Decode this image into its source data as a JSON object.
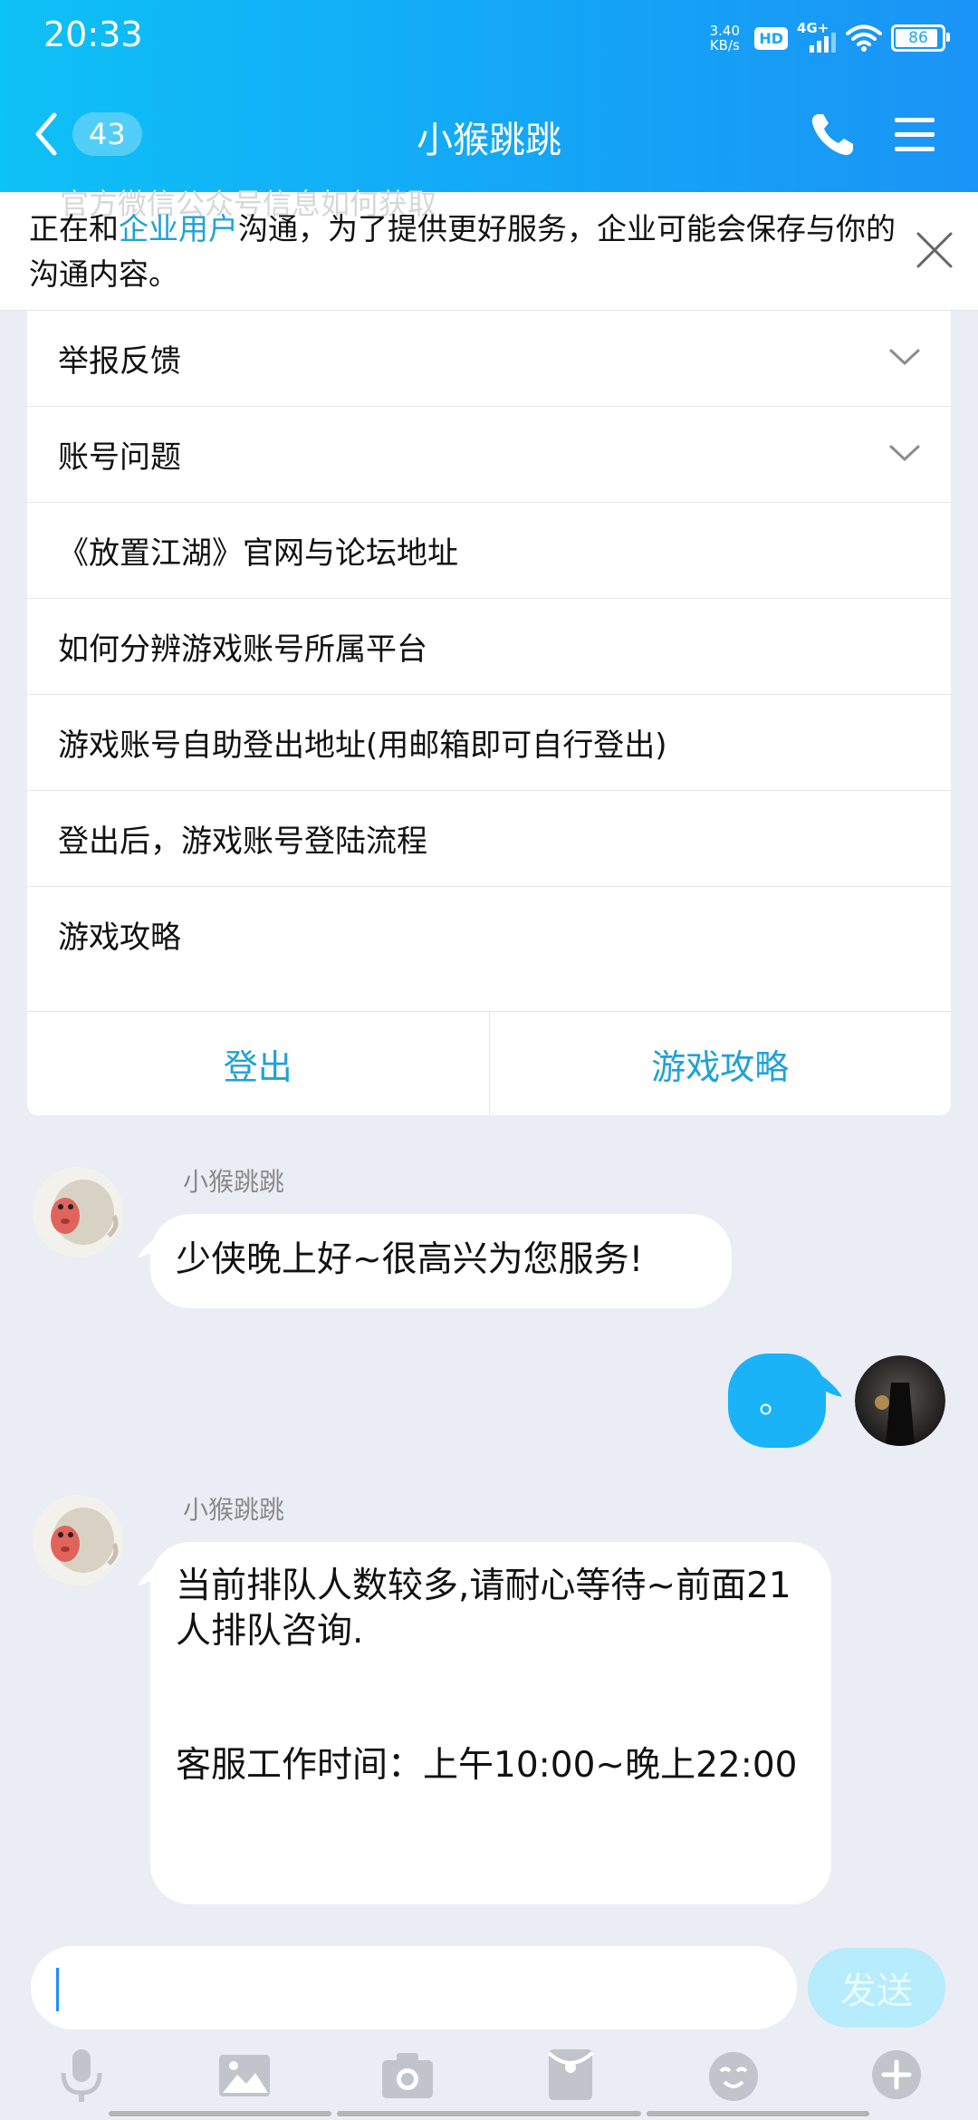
{
  "status": {
    "time": "20:33",
    "net_speed_value": "3.40",
    "net_speed_unit": "KB/s",
    "hd": "HD",
    "network": "4G+",
    "battery": "86",
    "battery_level": 0.86
  },
  "header": {
    "unread_count": "43",
    "title": "小猴跳跳"
  },
  "notice": {
    "prefix": "正在和",
    "highlight": "企业用户",
    "suffix": "沟通，为了提供更好服务，企业可能会保存与你的沟通内容。",
    "ghost_text": "官方微信公众号信息如何获取"
  },
  "menu": {
    "items": [
      {
        "label": "举报反馈",
        "expandable": true
      },
      {
        "label": "账号问题",
        "expandable": true
      },
      {
        "label": "《放置江湖》官网与论坛地址"
      },
      {
        "label": "如何分辨游戏账号所属平台"
      },
      {
        "label": "游戏账号自助登出地址(用邮箱即可自行登出)"
      },
      {
        "label": "登出后，游戏账号登陆流程"
      },
      {
        "label": "游戏攻略"
      }
    ],
    "actions": [
      "登出",
      "游戏攻略"
    ]
  },
  "messages": [
    {
      "sender": "小猴跳跳",
      "text": "少侠晚上好~很高兴为您服务!"
    },
    {
      "sender": "me",
      "text": "。"
    },
    {
      "sender": "小猴跳跳",
      "line1": "当前排队人数较多,请耐心等待~前面21人排队咨询.",
      "line2": "客服工作时间：上午10:00~晚上22:00"
    }
  ],
  "input": {
    "value": "",
    "send_label": "发送"
  },
  "toolbar": [
    "mic-icon",
    "image-icon",
    "camera-icon",
    "red-packet-icon",
    "emoji-icon",
    "plus-icon"
  ],
  "colors": {
    "header": "#14a6f7",
    "link": "#1fa1d9",
    "my_bubble": "#1ab3f7",
    "send_disabled": "#b6ecfb",
    "background": "#ebedf5"
  }
}
